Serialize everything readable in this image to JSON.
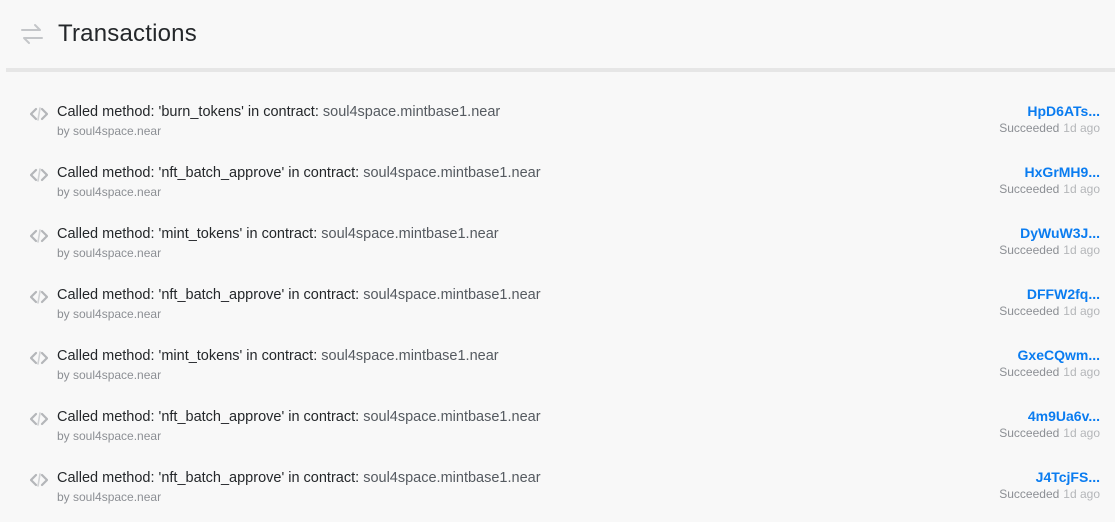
{
  "header": {
    "title": "Transactions",
    "icon": "arrows-exchange-icon"
  },
  "colors": {
    "hash_link": "#0a7cf0",
    "title_text": "#24272a",
    "muted_text": "#8c8f94",
    "background": "#f8f8f8"
  },
  "transactions": [
    {
      "prefix": "Called method: 'burn_tokens' in contract: ",
      "contract": "soul4space.mintbase1.near",
      "signer": "by soul4space.near",
      "hash": "HpD6ATs...",
      "status": "Succeeded",
      "time": "1d ago",
      "icon": "code-brackets-icon"
    },
    {
      "prefix": "Called method: 'nft_batch_approve' in contract: ",
      "contract": "soul4space.mintbase1.near",
      "signer": "by soul4space.near",
      "hash": "HxGrMH9...",
      "status": "Succeeded",
      "time": "1d ago",
      "icon": "code-brackets-icon"
    },
    {
      "prefix": "Called method: 'mint_tokens' in contract: ",
      "contract": "soul4space.mintbase1.near",
      "signer": "by soul4space.near",
      "hash": "DyWuW3J...",
      "status": "Succeeded",
      "time": "1d ago",
      "icon": "code-brackets-icon"
    },
    {
      "prefix": "Called method: 'nft_batch_approve' in contract: ",
      "contract": "soul4space.mintbase1.near",
      "signer": "by soul4space.near",
      "hash": "DFFW2fq...",
      "status": "Succeeded",
      "time": "1d ago",
      "icon": "code-brackets-icon"
    },
    {
      "prefix": "Called method: 'mint_tokens' in contract: ",
      "contract": "soul4space.mintbase1.near",
      "signer": "by soul4space.near",
      "hash": "GxeCQwm...",
      "status": "Succeeded",
      "time": "1d ago",
      "icon": "code-brackets-icon"
    },
    {
      "prefix": "Called method: 'nft_batch_approve' in contract: ",
      "contract": "soul4space.mintbase1.near",
      "signer": "by soul4space.near",
      "hash": "4m9Ua6v...",
      "status": "Succeeded",
      "time": "1d ago",
      "icon": "code-brackets-icon"
    },
    {
      "prefix": "Called method: 'nft_batch_approve' in contract: ",
      "contract": "soul4space.mintbase1.near",
      "signer": "by soul4space.near",
      "hash": "J4TcjFS...",
      "status": "Succeeded",
      "time": "1d ago",
      "icon": "code-brackets-icon"
    }
  ]
}
